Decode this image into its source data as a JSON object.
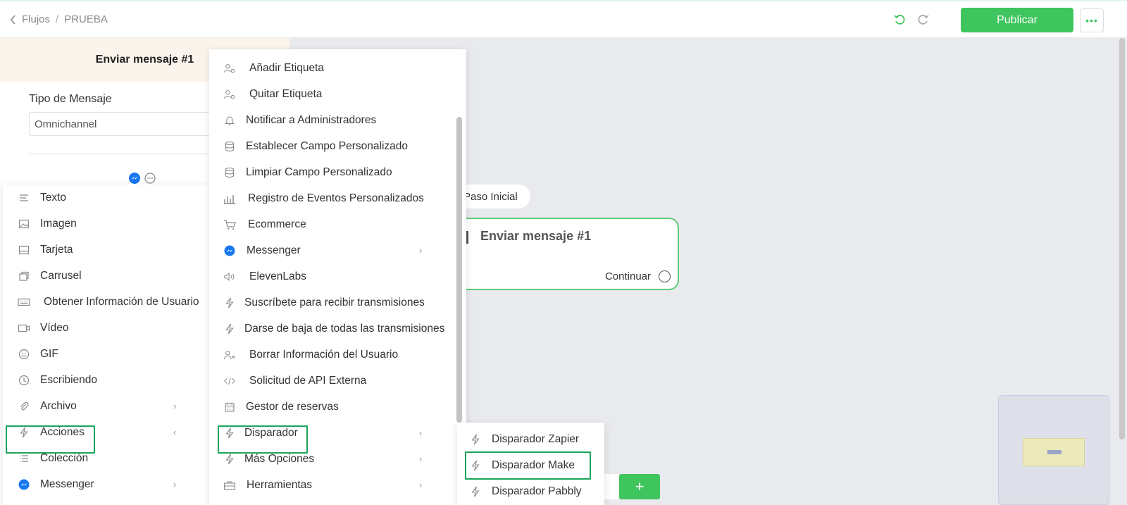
{
  "header": {
    "breadcrumb": [
      "Flujos",
      "PRUEBA"
    ],
    "breadcrumb_sep": "/",
    "publish_label": "Publicar",
    "more_label": "•••"
  },
  "editor": {
    "title": "Enviar mensaje #1",
    "message_type_label": "Tipo de Mensaje",
    "message_type_value": "Omnichannel"
  },
  "canvas": {
    "start_label": "Paso Inicial",
    "node_title": "Enviar mensaje #1",
    "node_continue": "Continuar",
    "add_label": "+"
  },
  "menu_main": {
    "items": [
      {
        "label": "Texto",
        "icon": "text-icon"
      },
      {
        "label": "Imagen",
        "icon": "image-icon"
      },
      {
        "label": "Tarjeta",
        "icon": "card-icon"
      },
      {
        "label": "Carrusel",
        "icon": "carousel-icon"
      },
      {
        "label": "Obtener Información de Usuario",
        "icon": "keyboard-icon"
      },
      {
        "label": "Vídeo",
        "icon": "video-icon"
      },
      {
        "label": "GIF",
        "icon": "gif-icon"
      },
      {
        "label": "Escribiendo",
        "icon": "clock-icon"
      },
      {
        "label": "Archivo",
        "icon": "paperclip-icon",
        "submenu": true
      },
      {
        "label": "Acciones",
        "icon": "bolt-icon",
        "submenu": true,
        "selected": true
      },
      {
        "label": "Colección",
        "icon": "list-icon"
      },
      {
        "label": "Messenger",
        "icon": "messenger-icon",
        "submenu": true
      }
    ]
  },
  "menu_actions": {
    "items": [
      {
        "label": "Añadir Etiqueta",
        "icon": "user-tag-icon"
      },
      {
        "label": "Quitar Etiqueta",
        "icon": "user-tag-icon"
      },
      {
        "label": "Notificar a Administradores",
        "icon": "bell-icon"
      },
      {
        "label": "Establecer Campo Personalizado",
        "icon": "database-icon"
      },
      {
        "label": "Limpiar Campo Personalizado",
        "icon": "database-icon"
      },
      {
        "label": "Registro de Eventos Personalizados",
        "icon": "bar-chart-icon"
      },
      {
        "label": "Ecommerce",
        "icon": "cart-icon"
      },
      {
        "label": "Messenger",
        "icon": "messenger-icon",
        "submenu": true
      },
      {
        "label": "ElevenLabs",
        "icon": "speaker-icon"
      },
      {
        "label": "Suscríbete para recibir transmisiones",
        "icon": "bolt-icon"
      },
      {
        "label": "Darse de baja de todas las transmisiones",
        "icon": "bolt-icon"
      },
      {
        "label": "Borrar Información del Usuario",
        "icon": "user-remove-icon"
      },
      {
        "label": "Solicitud de API Externa",
        "icon": "code-icon"
      },
      {
        "label": "Gestor de reservas",
        "icon": "calendar-icon"
      },
      {
        "label": "Disparador",
        "icon": "bolt-icon",
        "submenu": true,
        "selected": true
      },
      {
        "label": "Más Opciones",
        "icon": "bolt-icon",
        "submenu": true
      },
      {
        "label": "Herramientas",
        "icon": "toolbox-icon",
        "submenu": true
      }
    ]
  },
  "menu_triggers": {
    "items": [
      {
        "label": "Disparador Zapier",
        "icon": "bolt-icon"
      },
      {
        "label": "Disparador Make",
        "icon": "bolt-icon",
        "selected": true
      },
      {
        "label": "Disparador Pabbly",
        "icon": "bolt-icon"
      }
    ]
  },
  "colors": {
    "accent": "#3fc55d",
    "highlight": "#1aa55a",
    "messenger": "#1877f2"
  }
}
